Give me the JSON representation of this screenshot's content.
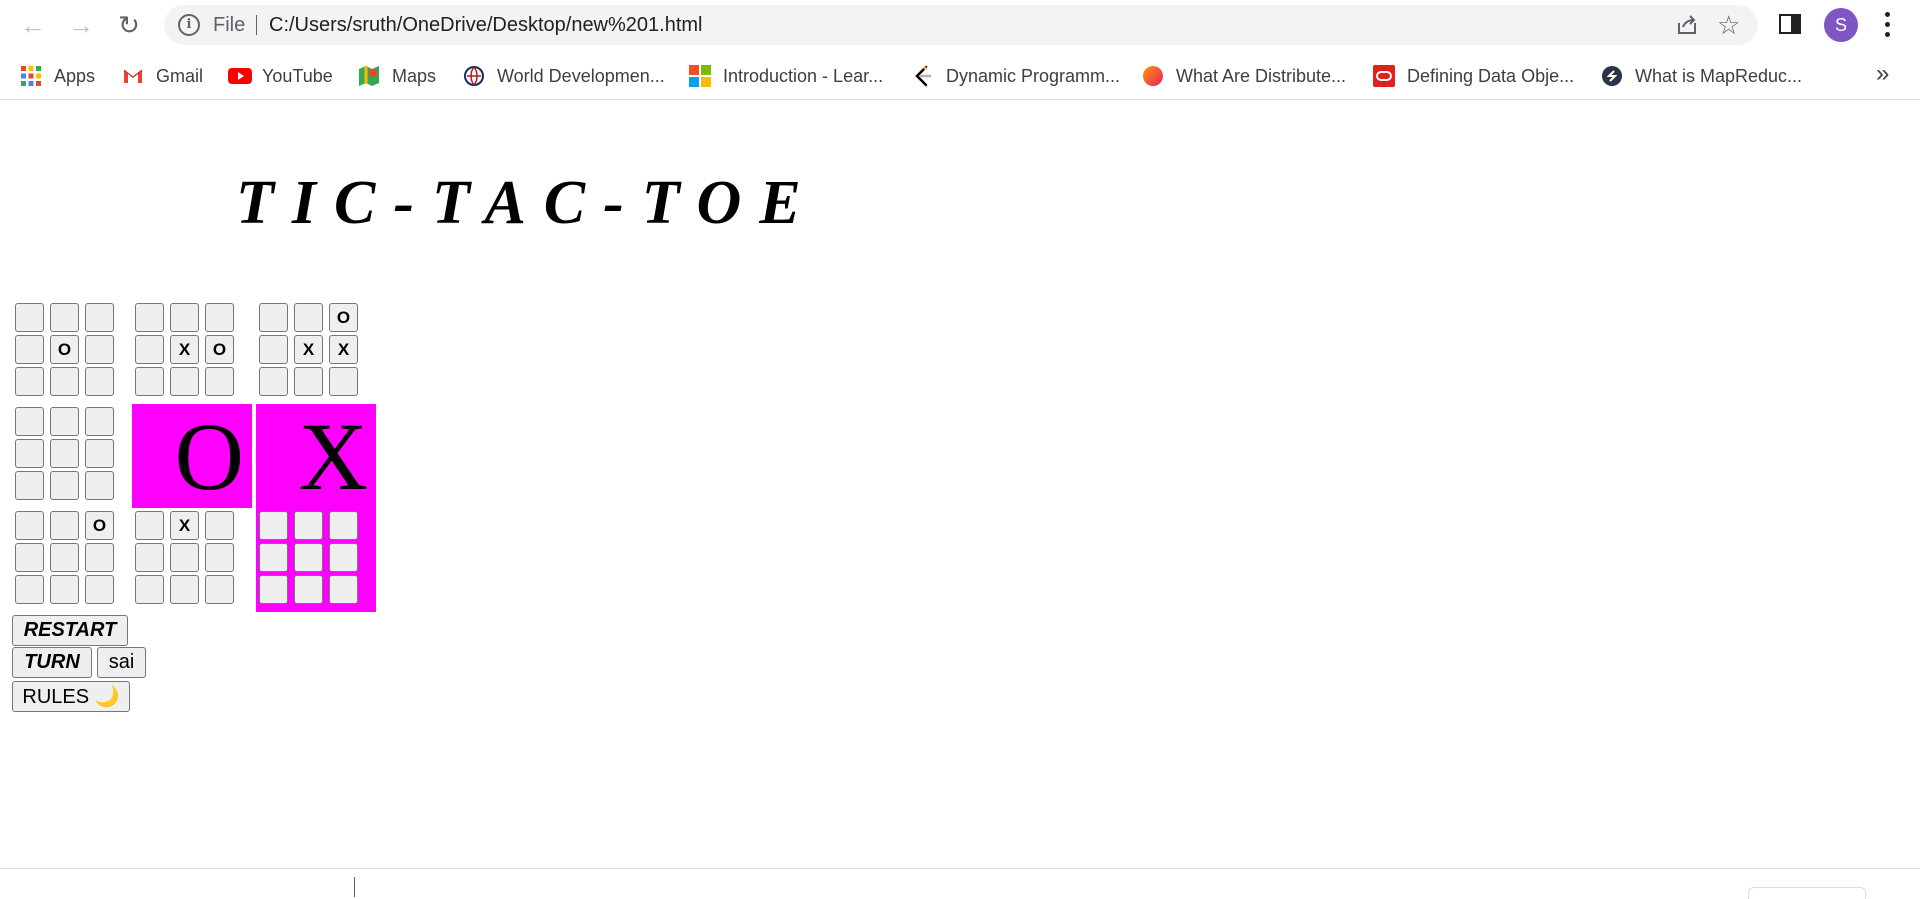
{
  "browser": {
    "back_icon": "arrow-left",
    "forward_icon": "arrow-right",
    "reload_icon": "reload",
    "address": {
      "scheme_label": "File",
      "url": "C:/Users/sruth/OneDrive/Desktop/new%201.html"
    },
    "profile_initial": "S",
    "bookmarks": [
      {
        "label": "Apps",
        "icon": "apps-grid-icon"
      },
      {
        "label": "Gmail",
        "icon": "gmail-icon"
      },
      {
        "label": "YouTube",
        "icon": "youtube-icon"
      },
      {
        "label": "Maps",
        "icon": "maps-icon"
      },
      {
        "label": "World Developmen...",
        "icon": "world-bank-icon"
      },
      {
        "label": "Introduction - Lear...",
        "icon": "microsoft-icon"
      },
      {
        "label": "Dynamic Programm...",
        "icon": "leetcode-icon"
      },
      {
        "label": "What Are Distribute...",
        "icon": "orange-circle-icon"
      },
      {
        "label": "Defining Data Obje...",
        "icon": "oracle-icon"
      },
      {
        "label": "What is MapReduc...",
        "icon": "dark-circle-icon"
      }
    ],
    "bookmarks_overflow": "»"
  },
  "page": {
    "title": "TIC-TAC-TOE",
    "accent_color": "#ff00ff",
    "board": {
      "subboards": [
        {
          "cells": [
            "",
            "",
            "",
            "",
            "O",
            "",
            "",
            "",
            ""
          ],
          "winner": ""
        },
        {
          "cells": [
            "",
            "",
            "",
            "",
            "X",
            "O",
            "",
            "",
            ""
          ],
          "winner": ""
        },
        {
          "cells": [
            "",
            "",
            "O",
            "",
            "X",
            "X",
            "",
            "",
            ""
          ],
          "winner": ""
        },
        {
          "cells": [
            "",
            "",
            "",
            "",
            "",
            "",
            "",
            "",
            ""
          ],
          "winner": ""
        },
        {
          "cells": [
            "",
            "",
            "",
            "",
            "",
            "",
            "",
            "",
            ""
          ],
          "winner": "O"
        },
        {
          "cells": [
            "",
            "",
            "",
            "",
            "",
            "",
            "",
            "",
            ""
          ],
          "winner": "X"
        },
        {
          "cells": [
            "",
            "",
            "O",
            "",
            "",
            "",
            "",
            "",
            ""
          ],
          "winner": ""
        },
        {
          "cells": [
            "",
            "X",
            "",
            "",
            "",
            "",
            "",
            "",
            ""
          ],
          "winner": ""
        },
        {
          "cells": [
            "",
            "",
            "",
            "",
            "",
            "",
            "",
            "",
            ""
          ],
          "winner": "",
          "active": true
        }
      ]
    },
    "buttons": {
      "restart": "RESTART",
      "turn": "TURN",
      "player": "sai",
      "rules": "RULES 🌙"
    }
  }
}
